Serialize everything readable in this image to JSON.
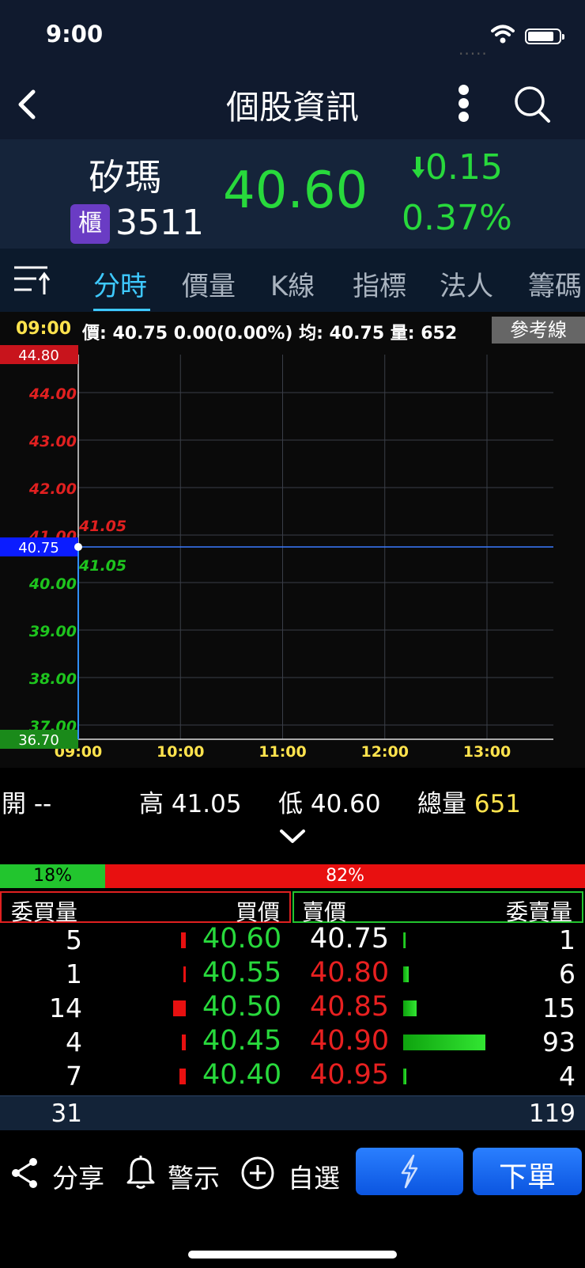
{
  "status": {
    "time": "9:00",
    "signal": "....."
  },
  "nav": {
    "title": "個股資訊"
  },
  "quote": {
    "name": "矽瑪",
    "market_badge": "櫃",
    "code": "3511",
    "price": "40.60",
    "change": "0.15",
    "change_pct": "0.37%"
  },
  "tabs": [
    "分時",
    "價量",
    "K線",
    "指標",
    "法人",
    "籌碼"
  ],
  "chart": {
    "info_time": "09:00",
    "info_text": "價: 40.75 0.00(0.00%) 均: 40.75 量: 652",
    "ref_button": "參考線",
    "ymax_label": "44.80",
    "ymin_label": "36.70",
    "current_label": "40.75",
    "high_marker": "41.05",
    "low_marker": "41.05"
  },
  "chart_data": {
    "type": "line",
    "x_ticks": [
      "09:00",
      "10:00",
      "11:00",
      "12:00",
      "13:00"
    ],
    "y_ticks_up": [
      "44.00",
      "43.00",
      "42.00",
      "41.00"
    ],
    "y_ticks_down": [
      "40.00",
      "39.00",
      "38.00",
      "37.00"
    ],
    "ylim": [
      36.7,
      44.8
    ],
    "reference": 40.75,
    "series": [
      {
        "x": [
          "09:00"
        ],
        "y": [
          40.75
        ]
      }
    ],
    "colors": {
      "up": "#e02020",
      "down": "#1ec41e",
      "reference": "#3b7bff",
      "price": "#2f8fff"
    }
  },
  "ohlc": {
    "open_label": "開",
    "open_value": "--",
    "high_label": "高",
    "high_value": "41.05",
    "low_label": "低",
    "low_value": "40.60",
    "volume_label": "總量",
    "volume_value": "651"
  },
  "ratio": {
    "bid_pct": 0.18,
    "bid_label": "18%",
    "ask_label": "82%"
  },
  "orderbook": {
    "headers": {
      "bid_qty": "委買量",
      "bid_price": "買價",
      "ask_price": "賣價",
      "ask_qty": "委賣量"
    },
    "rows": [
      {
        "bid_qty": "5",
        "bid_price": "40.60",
        "ask_price": "40.75",
        "ask_qty": "1",
        "bid_bar": 5,
        "ask_bar": 1
      },
      {
        "bid_qty": "1",
        "bid_price": "40.55",
        "ask_price": "40.80",
        "ask_qty": "6",
        "bid_bar": 1,
        "ask_bar": 6
      },
      {
        "bid_qty": "14",
        "bid_price": "40.50",
        "ask_price": "40.85",
        "ask_qty": "15",
        "bid_bar": 14,
        "ask_bar": 15
      },
      {
        "bid_qty": "4",
        "bid_price": "40.45",
        "ask_price": "40.90",
        "ask_qty": "93",
        "bid_bar": 4,
        "ask_bar": 93
      },
      {
        "bid_qty": "7",
        "bid_price": "40.40",
        "ask_price": "40.95",
        "ask_qty": "4",
        "bid_bar": 7,
        "ask_bar": 4
      }
    ],
    "total_bid": "31",
    "total_ask": "119"
  },
  "footer": {
    "share": "分享",
    "alert": "警示",
    "watchlist": "自選",
    "order": "下單"
  },
  "icons": [
    "back-icon",
    "more-icon",
    "search-icon",
    "menu-sort-icon",
    "chevron-down-icon",
    "share-icon",
    "bell-icon",
    "plus-circle-icon",
    "lightning-icon",
    "down-arrow-icon",
    "wifi-icon",
    "battery-icon"
  ]
}
